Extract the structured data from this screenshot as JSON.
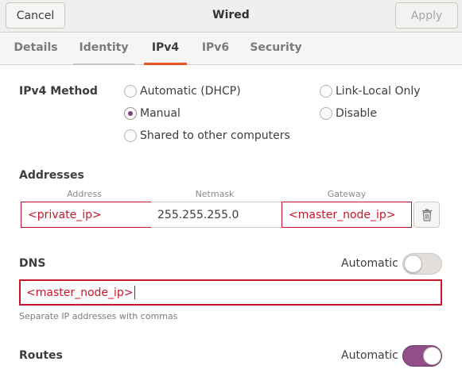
{
  "header": {
    "cancel_label": "Cancel",
    "title": "Wired",
    "apply_label": "Apply"
  },
  "tabs": [
    {
      "label": "Details",
      "active": false
    },
    {
      "label": "Identity",
      "active": false
    },
    {
      "label": "IPv4",
      "active": true
    },
    {
      "label": "IPv6",
      "active": false
    },
    {
      "label": "Security",
      "active": false
    }
  ],
  "ipv4_method": {
    "label": "IPv4 Method",
    "options": [
      {
        "label": "Automatic (DHCP)",
        "checked": false
      },
      {
        "label": "Link-Local Only",
        "checked": false
      },
      {
        "label": "Manual",
        "checked": true
      },
      {
        "label": "Disable",
        "checked": false
      },
      {
        "label": "Shared to other computers",
        "checked": false
      }
    ]
  },
  "addresses": {
    "label": "Addresses",
    "columns": [
      "Address",
      "Netmask",
      "Gateway"
    ],
    "row": {
      "address": "<private_ip>",
      "netmask": "255.255.255.0",
      "gateway": "<master_node_ip>"
    },
    "delete_icon": "trash-icon"
  },
  "dns": {
    "label": "DNS",
    "automatic_label": "Automatic",
    "automatic_on": false,
    "value": "<master_node_ip>",
    "hint": "Separate IP addresses with commas"
  },
  "routes": {
    "label": "Routes",
    "automatic_label": "Automatic",
    "automatic_on": true
  },
  "colors": {
    "accent_tab": "#e95420",
    "radio_checked": "#7f3e7f",
    "switch_on": "#924d8b",
    "error": "#c7162b"
  }
}
